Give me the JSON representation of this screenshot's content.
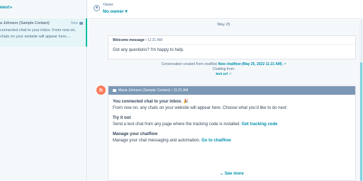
{
  "list": {
    "sort_label": "west",
    "conversation": {
      "contact_name": "a Johnson (Sample Contact)",
      "time": "Now",
      "preview": "connected chat to your inbox. From now on, chats on your website will appear here...."
    }
  },
  "header": {
    "owner_label": "Owner",
    "owner_value": "No owner"
  },
  "thread": {
    "date": "May 25",
    "welcome": {
      "title": "Welcome message",
      "time": "11:21 AM",
      "text": "Got any questions? I'm happy to help."
    },
    "created": {
      "prefix": "Conversation created from chatflow",
      "link": "New chatflow (May 25, 2022 11:21 AM)",
      "chatting_label": "Chatting from:",
      "chatting_link": "test url"
    },
    "avatar_letter": "h",
    "message": {
      "sender": "Maria Johnson (Sample Contact)",
      "time": "11:21 AM",
      "title": "You connected chat to your inbox. 🎉",
      "intro": "From now on, any chats on your website will appear here. Choose what you'd like to do next:",
      "sections": [
        {
          "heading": "Try it out",
          "text": "Send a test chat from any page where the tracking code is installed.",
          "link": "Get tracking code"
        },
        {
          "heading": "Manage your chatflow",
          "text": "Manage your chat messaging and automation.",
          "link": "Go to chatflow"
        }
      ],
      "see_more": "See more"
    }
  },
  "colors": {
    "accent": "#0091ae",
    "sender_bar": "#7c98b6",
    "brand": "#ff7a59",
    "selected": "#e5f5f8"
  },
  "icons": {
    "sort": "chevron-down-icon",
    "channel": "chat-icon",
    "owner": "user-icon",
    "external": "external-link-icon",
    "brand": "hubspot-icon"
  }
}
